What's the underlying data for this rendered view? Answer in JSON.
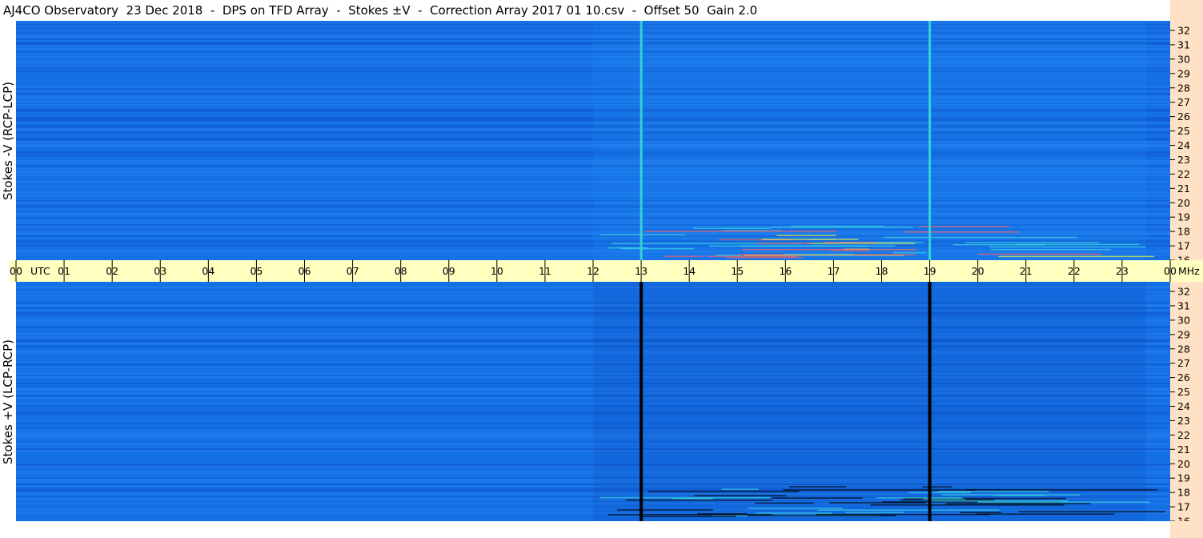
{
  "title": "AJ4CO Observatory  23 Dec 2018  -  DPS on TFD Array  -  Stokes ±V  -  Correction Array 2017 01 10.csv  -  Offset 50  Gain 2.0",
  "colors": {
    "spectrogram_base": "#1570e6",
    "axis_strip": "#ffffc0",
    "right_strip": "#ffe2c6",
    "cyan_marker": "#35d0d8",
    "black_marker": "#000000"
  },
  "chart_data": [
    {
      "type": "heatmap",
      "panel": "top",
      "ylabel": "Stokes -V  (RCP-LCP)",
      "y_unit": "MHz",
      "ylim": [
        16,
        32
      ],
      "yticks": [
        "16",
        "17",
        "18",
        "19",
        "20",
        "21",
        "22",
        "23",
        "24",
        "25",
        "26",
        "27",
        "28",
        "29",
        "30",
        "31",
        "32"
      ],
      "xlim": [
        0,
        24
      ],
      "marker_lines_utc": [
        13,
        19
      ],
      "marker_color": "cyan"
    },
    {
      "type": "heatmap",
      "panel": "bottom",
      "ylabel": "Stokes +V  (LCP-RCP)",
      "y_unit": "MHz",
      "ylim": [
        16,
        32
      ],
      "yticks": [
        "16",
        "17",
        "18",
        "19",
        "20",
        "21",
        "22",
        "23",
        "24",
        "25",
        "26",
        "27",
        "28",
        "29",
        "30",
        "31",
        "32"
      ],
      "xlim": [
        0,
        24
      ],
      "marker_lines_utc": [
        13,
        19
      ],
      "marker_color": "black"
    }
  ],
  "time_axis": {
    "unit_label": "UTC",
    "end_unit": "MHz",
    "ticks": [
      "00",
      "01",
      "02",
      "03",
      "04",
      "05",
      "06",
      "07",
      "08",
      "09",
      "10",
      "11",
      "12",
      "13",
      "14",
      "15",
      "16",
      "17",
      "18",
      "19",
      "20",
      "21",
      "22",
      "23",
      "00"
    ]
  }
}
